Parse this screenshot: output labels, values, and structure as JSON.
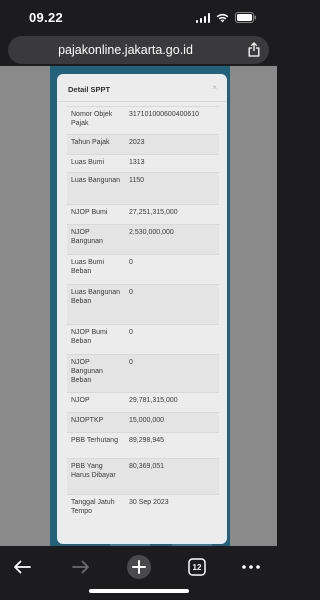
{
  "status_bar": {
    "time": "09.22"
  },
  "url_bar": {
    "url": "pajakonline.jakarta.go.id"
  },
  "modal": {
    "title": "Detail SPPT",
    "close_label": "×",
    "rows": [
      {
        "label": "Nomor Objek Pajak",
        "value": "317101000600400610"
      },
      {
        "label": "Tahun Pajak",
        "value": "2023"
      },
      {
        "label": "Luas Bumi",
        "value": "1313"
      },
      {
        "label": "Luas Bangunan",
        "value": "1150"
      },
      {
        "label": "NJOP Bumi",
        "value": "27,251,315,000"
      },
      {
        "label": "NJOP Bangunan",
        "value": "2,530,000,000"
      },
      {
        "label": "Luas Bumi Beban",
        "value": "0"
      },
      {
        "label": "Luas Bangunan Beban",
        "value": "0"
      },
      {
        "label": "NJOP Bumi Beban",
        "value": "0"
      },
      {
        "label": "NJOP Bangunan Beban",
        "value": "0"
      },
      {
        "label": "NJOP",
        "value": "29,781,315,000"
      },
      {
        "label": "NJOPTKP",
        "value": "15,000,000"
      },
      {
        "label": "PBB Terhutang",
        "value": "89,298,945"
      },
      {
        "label": "PBB Yang Harus Dibayar",
        "value": "80,369,051"
      },
      {
        "label": "Tanggal Jatuh Tempo",
        "value": "30 Sep 2023"
      }
    ]
  },
  "toolbar": {
    "tabs_count": "12"
  },
  "icons": {
    "back": "arrow-left-icon",
    "forward": "arrow-right-icon",
    "new_tab": "plus-icon",
    "tabs": "tabs-icon",
    "more": "more-icon",
    "share": "share-icon"
  }
}
